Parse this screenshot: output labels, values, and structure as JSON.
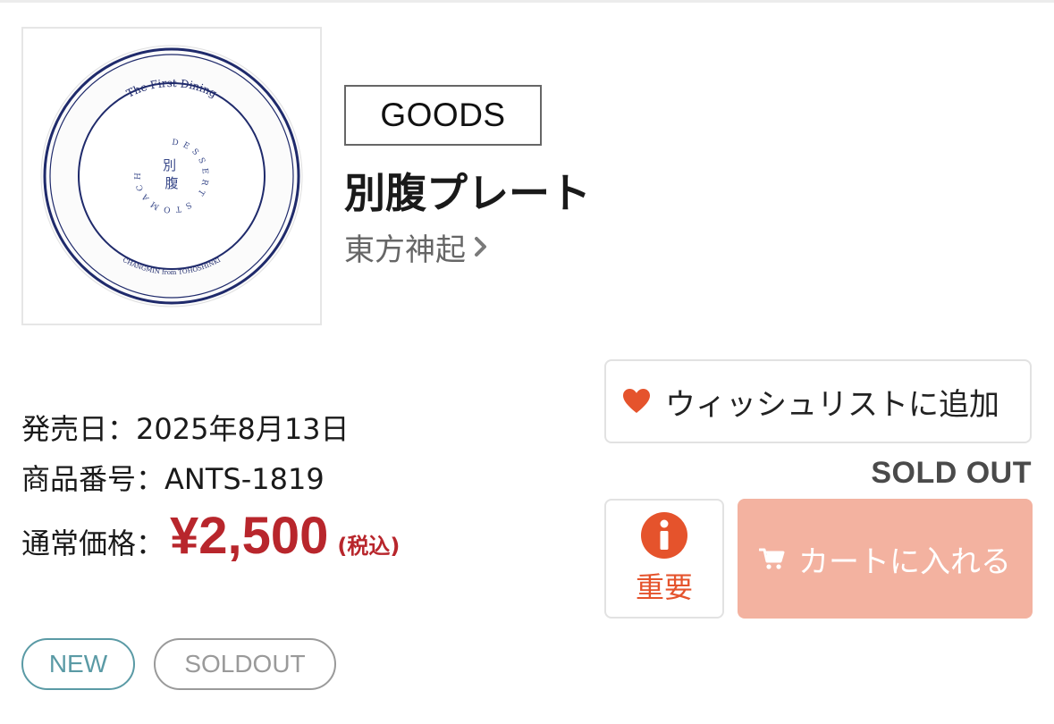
{
  "product": {
    "category": "GOODS",
    "title": "別腹プレート",
    "artist": "東方神起",
    "image": {
      "alt": "別腹プレート",
      "plate_text_top": "The First Dining",
      "plate_text_center": "別腹",
      "plate_text_ring": "DESSERT STOMACH",
      "plate_text_bottom": "CHANGMIN from TOHOSHINKI"
    }
  },
  "meta": {
    "release_label": "発売日：",
    "release_date": "2025年8月13日",
    "code_label": "商品番号：",
    "code": "ANTS-1819",
    "price_label": "通常価格：",
    "price": "¥2,500",
    "tax_note": "(税込)"
  },
  "actions": {
    "wishlist_label": "ウィッシュリストに追加",
    "status": "SOLD OUT",
    "important_label": "重要",
    "cart_label": "カートに入れる"
  },
  "tags": [
    "NEW",
    "SOLDOUT"
  ],
  "colors": {
    "price": "#b8262c",
    "accent_orange": "#e5532c",
    "cart_disabled": "#f3b2a0",
    "tag_new": "#5a9aa5",
    "tag_soldout": "#9a9a9a",
    "plate_navy": "#1f2a6b"
  },
  "icons": {
    "wishlist": "heart-icon",
    "artist_link": "chevron-right-icon",
    "important": "info-icon",
    "cart": "cart-icon"
  }
}
